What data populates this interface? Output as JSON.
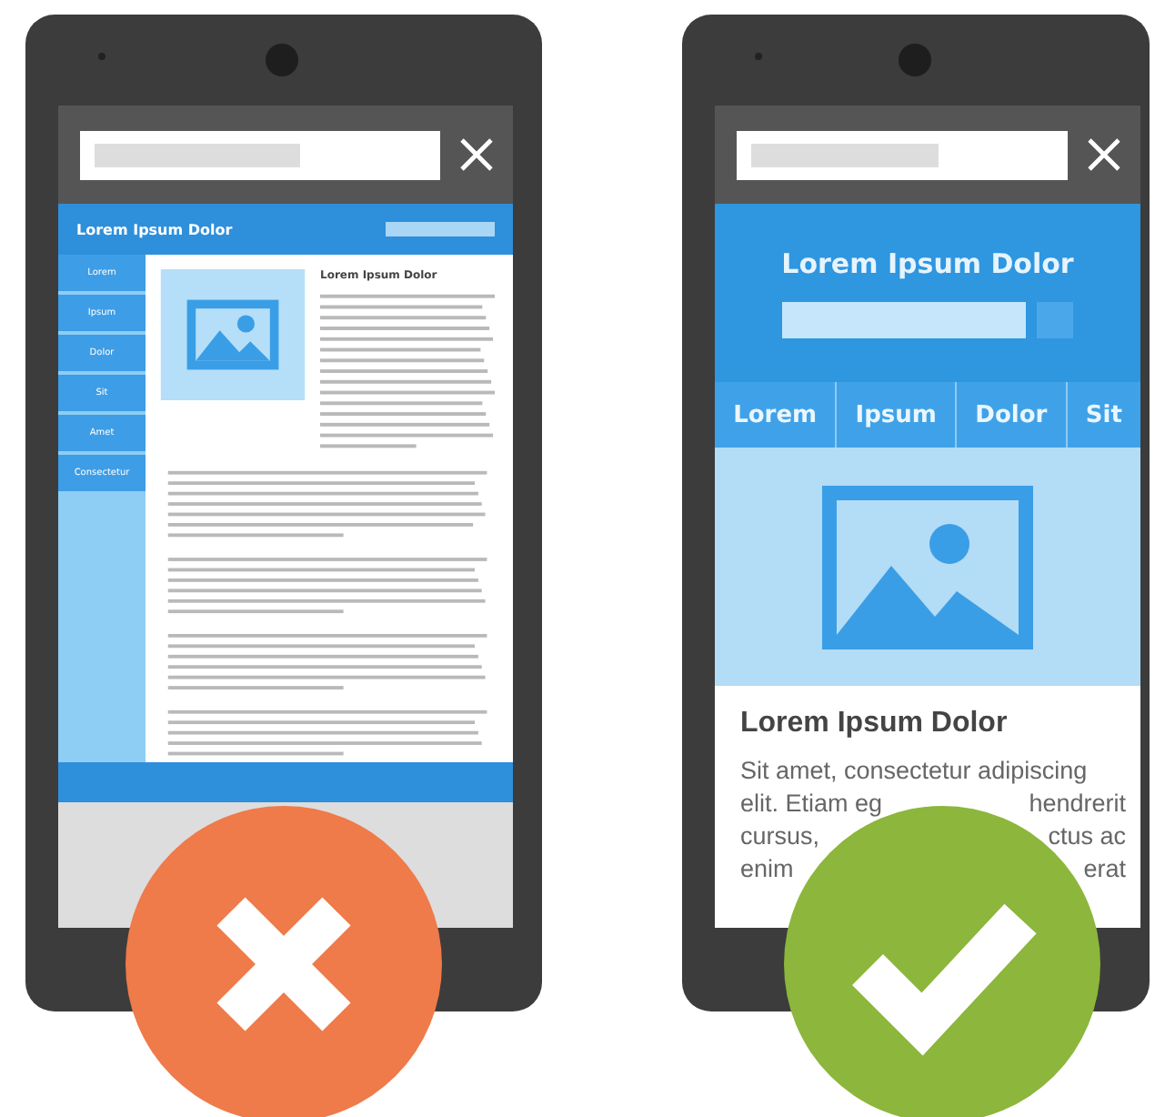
{
  "phones": [
    {
      "kind": "desktop",
      "header_title": "Lorem Ipsum Dolor",
      "nav": [
        "Lorem",
        "Ipsum",
        "Dolor",
        "Sit",
        "Amet",
        "Consectetur"
      ],
      "article_title": "Lorem Ipsum Dolor",
      "passed": false
    },
    {
      "kind": "mobile",
      "header_title": "Lorem Ipsum Dolor",
      "nav": [
        "Lorem",
        "Ipsum",
        "Dolor",
        "Sit"
      ],
      "article_title": "Lorem Ipsum Dolor",
      "paragraph_lines": [
        {
          "left": "Sit amet, consectetur adipiscing"
        },
        {
          "left": "elit. Etiam eg",
          "right": "hendrerit"
        },
        {
          "left": "cursus,",
          "right": "ctus ac"
        },
        {
          "left": "enim",
          "right": "erat"
        }
      ],
      "passed": true
    }
  ]
}
